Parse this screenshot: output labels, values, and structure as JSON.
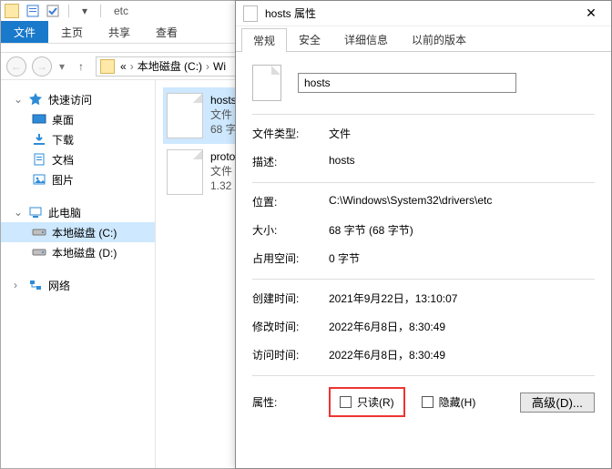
{
  "explorer": {
    "title": "etc",
    "tabs": {
      "file": "文件",
      "home": "主页",
      "share": "共享",
      "view": "查看"
    },
    "addr": {
      "prefix": "«",
      "drive": "本地磁盘 (C:)",
      "next": "Wi"
    },
    "nav": {
      "quick": {
        "label": "快速访问",
        "items": [
          {
            "label": "桌面"
          },
          {
            "label": "下载"
          },
          {
            "label": "文档"
          },
          {
            "label": "图片"
          }
        ]
      },
      "pc": {
        "label": "此电脑",
        "items": [
          {
            "label": "本地磁盘 (C:)"
          },
          {
            "label": "本地磁盘 (D:)"
          }
        ]
      },
      "net": {
        "label": "网络"
      }
    },
    "files": [
      {
        "name": "hosts",
        "type": "文件",
        "size": "68 字"
      },
      {
        "name": "proto",
        "type": "文件",
        "size": "1.32"
      }
    ]
  },
  "dialog": {
    "title": "hosts 属性",
    "tabs": [
      "常规",
      "安全",
      "详细信息",
      "以前的版本"
    ],
    "filename": "hosts",
    "rows": {
      "type_k": "文件类型:",
      "type_v": "文件",
      "desc_k": "描述:",
      "desc_v": "hosts",
      "loc_k": "位置:",
      "loc_v": "C:\\Windows\\System32\\drivers\\etc",
      "size_k": "大小:",
      "size_v": "68 字节 (68 字节)",
      "disk_k": "占用空间:",
      "disk_v": "0 字节",
      "ctime_k": "创建时间:",
      "ctime_v": "2021年9月22日，13:10:07",
      "mtime_k": "修改时间:",
      "mtime_v": "2022年6月8日，8:30:49",
      "atime_k": "访问时间:",
      "atime_v": "2022年6月8日，8:30:49",
      "attr_k": "属性:",
      "readonly": "只读(R)",
      "hidden": "隐藏(H)",
      "advanced": "高级(D)..."
    }
  }
}
